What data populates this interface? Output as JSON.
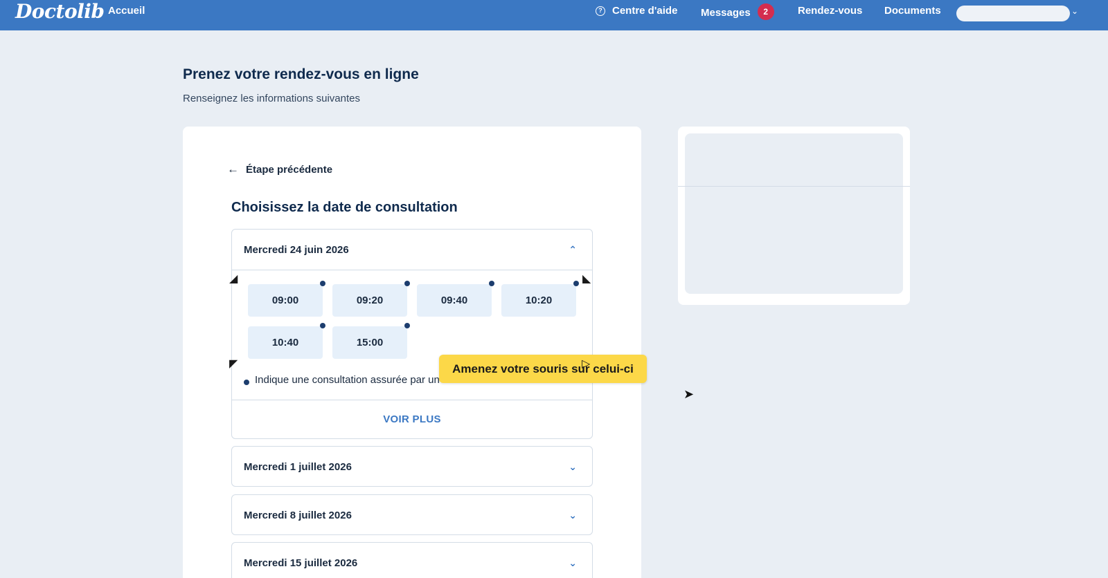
{
  "header": {
    "logo": "Doctolib",
    "home": "Accueil",
    "help": "Centre d'aide",
    "messages": "Messages",
    "messages_count": "2",
    "appointments": "Rendez-vous",
    "documents": "Documents",
    "brand_color": "#3b78c3"
  },
  "page": {
    "title": "Prenez votre rendez-vous en ligne",
    "subtitle": "Renseignez les informations suivantes"
  },
  "booking": {
    "back": "Étape précédente",
    "section_title": "Choisissez la date de consultation",
    "days": [
      {
        "label": "Mercredi 24 juin 2026",
        "slots": [
          "09:00",
          "09:20",
          "09:40",
          "10:20",
          "10:40",
          "15:00"
        ],
        "legend": "Indique une consultation assurée par un",
        "more": "VOIR PLUS"
      },
      {
        "label": "Mercredi 1 juillet 2026"
      },
      {
        "label": "Mercredi 8 juillet 2026"
      },
      {
        "label": "Mercredi 15 juillet 2026"
      }
    ]
  },
  "tooltip": {
    "text": "Amenez votre souris sur celui-ci"
  }
}
